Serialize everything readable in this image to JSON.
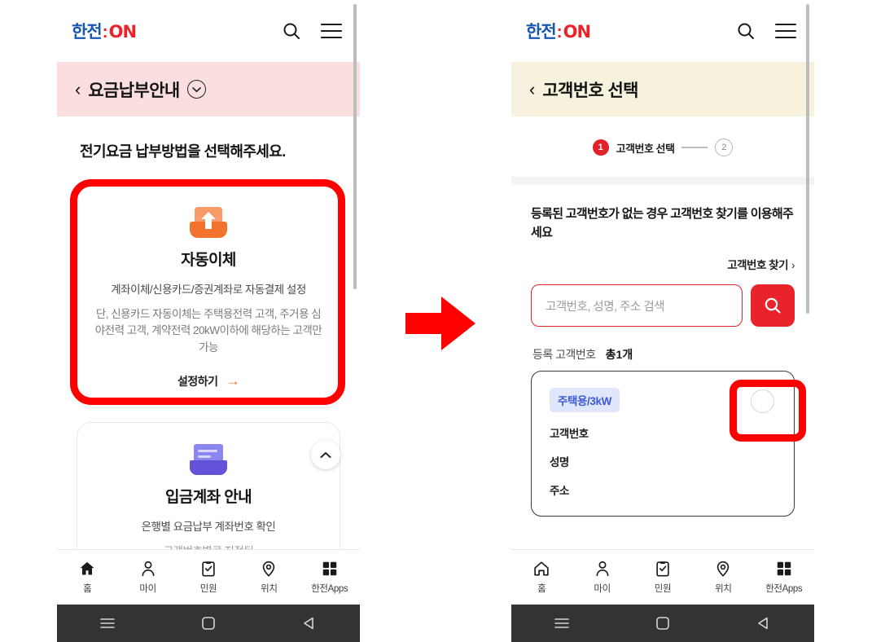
{
  "brand": {
    "logo_ko": "한전",
    "logo_colon": ":",
    "logo_on": "ON",
    "accent_red": "#e8242a",
    "accent_blue": "#1757b0",
    "highlight_red": "#fe0000"
  },
  "left_phone": {
    "header": {
      "search_icon": "search-icon",
      "menu_icon": "hamburger-menu-icon"
    },
    "title_bar": {
      "back": "‹",
      "title": "요금납부안내",
      "chevron_icon": "chevron-down-circle-icon",
      "background": "#fbdfe0"
    },
    "heading": "전기요금 납부방법을 선택해주세요.",
    "cards": [
      {
        "icon": "auto-debit-icon",
        "title": "자동이체",
        "subtitle": "계좌이체/신용카드/증권계좌로 자동결제 설정",
        "note": "단, 신용카드 자동이체는 주택용전력 고객, 주거용 심야전력 고객, 계약전력 20kW이하에 해당하는 고객만 가능",
        "cta": "설정하기",
        "cta_arrow": "→",
        "highlighted": true
      },
      {
        "icon": "bank-account-icon",
        "title": "입금계좌 안내",
        "subtitle": "은행별 요금납부 계좌번호 확인",
        "note": "고객번호별로 지정된",
        "cta": "",
        "cta_arrow": "",
        "highlighted": false
      }
    ],
    "collapse_button_icon": "chevron-up-icon",
    "bottom_nav": [
      {
        "icon": "home-icon",
        "label": "홈",
        "active": true
      },
      {
        "icon": "person-icon",
        "label": "마이",
        "active": false
      },
      {
        "icon": "clipboard-check-icon",
        "label": "민원",
        "active": false
      },
      {
        "icon": "location-pin-icon",
        "label": "위치",
        "active": false
      },
      {
        "icon": "grid-apps-icon",
        "label": "한전Apps",
        "active": false
      }
    ],
    "system_bar": [
      {
        "icon": "recents-icon"
      },
      {
        "icon": "home-square-icon"
      },
      {
        "icon": "back-triangle-icon"
      }
    ]
  },
  "right_phone": {
    "header": {
      "search_icon": "search-icon",
      "menu_icon": "hamburger-menu-icon"
    },
    "title_bar": {
      "back": "‹",
      "title": "고객번호 선택",
      "background": "#f7f2dd"
    },
    "stepper": {
      "step1_number": "1",
      "step1_label": "고객번호 선택",
      "step2_number": "2"
    },
    "notice": "등록된 고객번호가 없는 경우 고객번호 찾기를 이용해주세요",
    "find_link": "고객번호 찾기",
    "find_link_chevron": "›",
    "search": {
      "placeholder": "고객번호, 성명, 주소 검색",
      "value": "",
      "button_icon": "search-icon"
    },
    "registered": {
      "label": "등록 고객번호",
      "count": "총1개"
    },
    "customer_card": {
      "badge": "주택용/3kW",
      "fields": [
        "고객번호",
        "성명",
        "주소"
      ],
      "radio_icon": "radio-unselected-icon",
      "radio_highlighted": true
    },
    "bottom_nav": [
      {
        "icon": "home-icon",
        "label": "홈",
        "active": false
      },
      {
        "icon": "person-icon",
        "label": "마이",
        "active": false
      },
      {
        "icon": "clipboard-check-icon",
        "label": "민원",
        "active": false
      },
      {
        "icon": "location-pin-icon",
        "label": "위치",
        "active": false
      },
      {
        "icon": "grid-apps-icon",
        "label": "한전Apps",
        "active": false
      }
    ],
    "system_bar": [
      {
        "icon": "recents-icon"
      },
      {
        "icon": "home-square-icon"
      },
      {
        "icon": "back-triangle-icon"
      }
    ]
  },
  "flow_arrow": {
    "icon": "right-arrow-icon",
    "color": "#fe0000"
  }
}
